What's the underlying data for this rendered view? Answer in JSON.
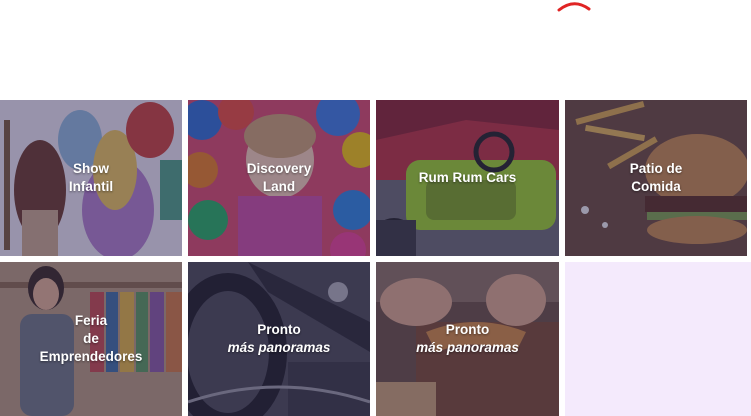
{
  "loader": {
    "icon": "loading-spinner-icon",
    "color": "#e02424"
  },
  "tiles": [
    {
      "lines": [
        "Show",
        "Infantil"
      ],
      "image": "princess-characters-image"
    },
    {
      "lines": [
        "Discovery",
        "Land"
      ],
      "image": "child-in-ball-pit-image"
    },
    {
      "lines": [
        "Rum Rum Cars"
      ],
      "image": "kids-ride-on-cars-image"
    },
    {
      "lines": [
        "Patio de",
        "Comida"
      ],
      "image": "burger-and-fries-image"
    },
    {
      "lines": [
        "Feria",
        "de",
        "Emprendedores"
      ],
      "image": "clothing-vendor-image"
    },
    {
      "lines": [
        "Pronto"
      ],
      "italic": "más panoramas",
      "image": "motorcycle-image"
    },
    {
      "lines": [
        "Pronto"
      ],
      "italic": "más panoramas",
      "image": "leather-craft-image"
    }
  ],
  "colors": {
    "overlay": "#28244e",
    "filler": "#f4eafc",
    "label": "#ffffff"
  }
}
